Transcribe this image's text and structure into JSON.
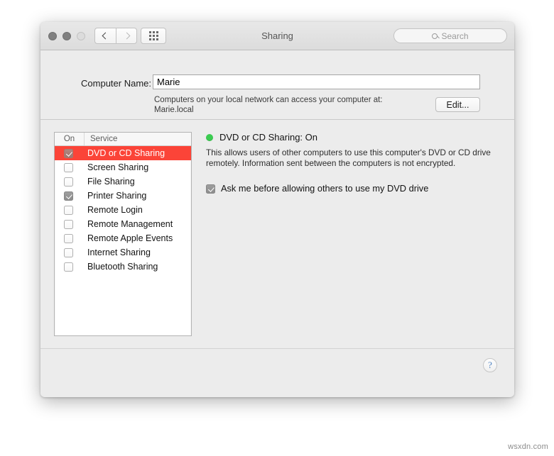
{
  "window": {
    "title": "Sharing",
    "traffic_lights": [
      "close",
      "minimize",
      "zoom"
    ],
    "nav": {
      "back": "back-arrow",
      "forward": "forward-arrow"
    },
    "showall_icon": "grid-dots-icon"
  },
  "search": {
    "placeholder": "Search",
    "icon": "search-icon"
  },
  "computer_name": {
    "label": "Computer Name:",
    "value": "Marie",
    "note_line1": "Computers on your local network can access your computer at:",
    "note_line2": "Marie.local",
    "edit_button": "Edit..."
  },
  "service_list": {
    "header": {
      "on": "On",
      "service": "Service"
    },
    "items": [
      {
        "label": "DVD or CD Sharing",
        "checked": true,
        "selected": true
      },
      {
        "label": "Screen Sharing",
        "checked": false,
        "selected": false
      },
      {
        "label": "File Sharing",
        "checked": false,
        "selected": false
      },
      {
        "label": "Printer Sharing",
        "checked": true,
        "selected": false
      },
      {
        "label": "Remote Login",
        "checked": false,
        "selected": false
      },
      {
        "label": "Remote Management",
        "checked": false,
        "selected": false
      },
      {
        "label": "Remote Apple Events",
        "checked": false,
        "selected": false
      },
      {
        "label": "Internet Sharing",
        "checked": false,
        "selected": false
      },
      {
        "label": "Bluetooth Sharing",
        "checked": false,
        "selected": false
      }
    ]
  },
  "detail": {
    "status_title": "DVD or CD Sharing: On",
    "status_color": "#3bcc51",
    "description": "This allows users of other computers to use this computer's DVD or CD drive remotely. Information sent between the computers is not encrypted.",
    "ask_checkbox_label": "Ask me before allowing others to use my DVD drive",
    "ask_checkbox_checked": true
  },
  "footer": {
    "help_label": "?"
  },
  "watermark": "wsxdn.com",
  "colors": {
    "selection_red": "#fb4438",
    "status_green": "#3bcc51",
    "help_blue": "#4a7fc1"
  }
}
